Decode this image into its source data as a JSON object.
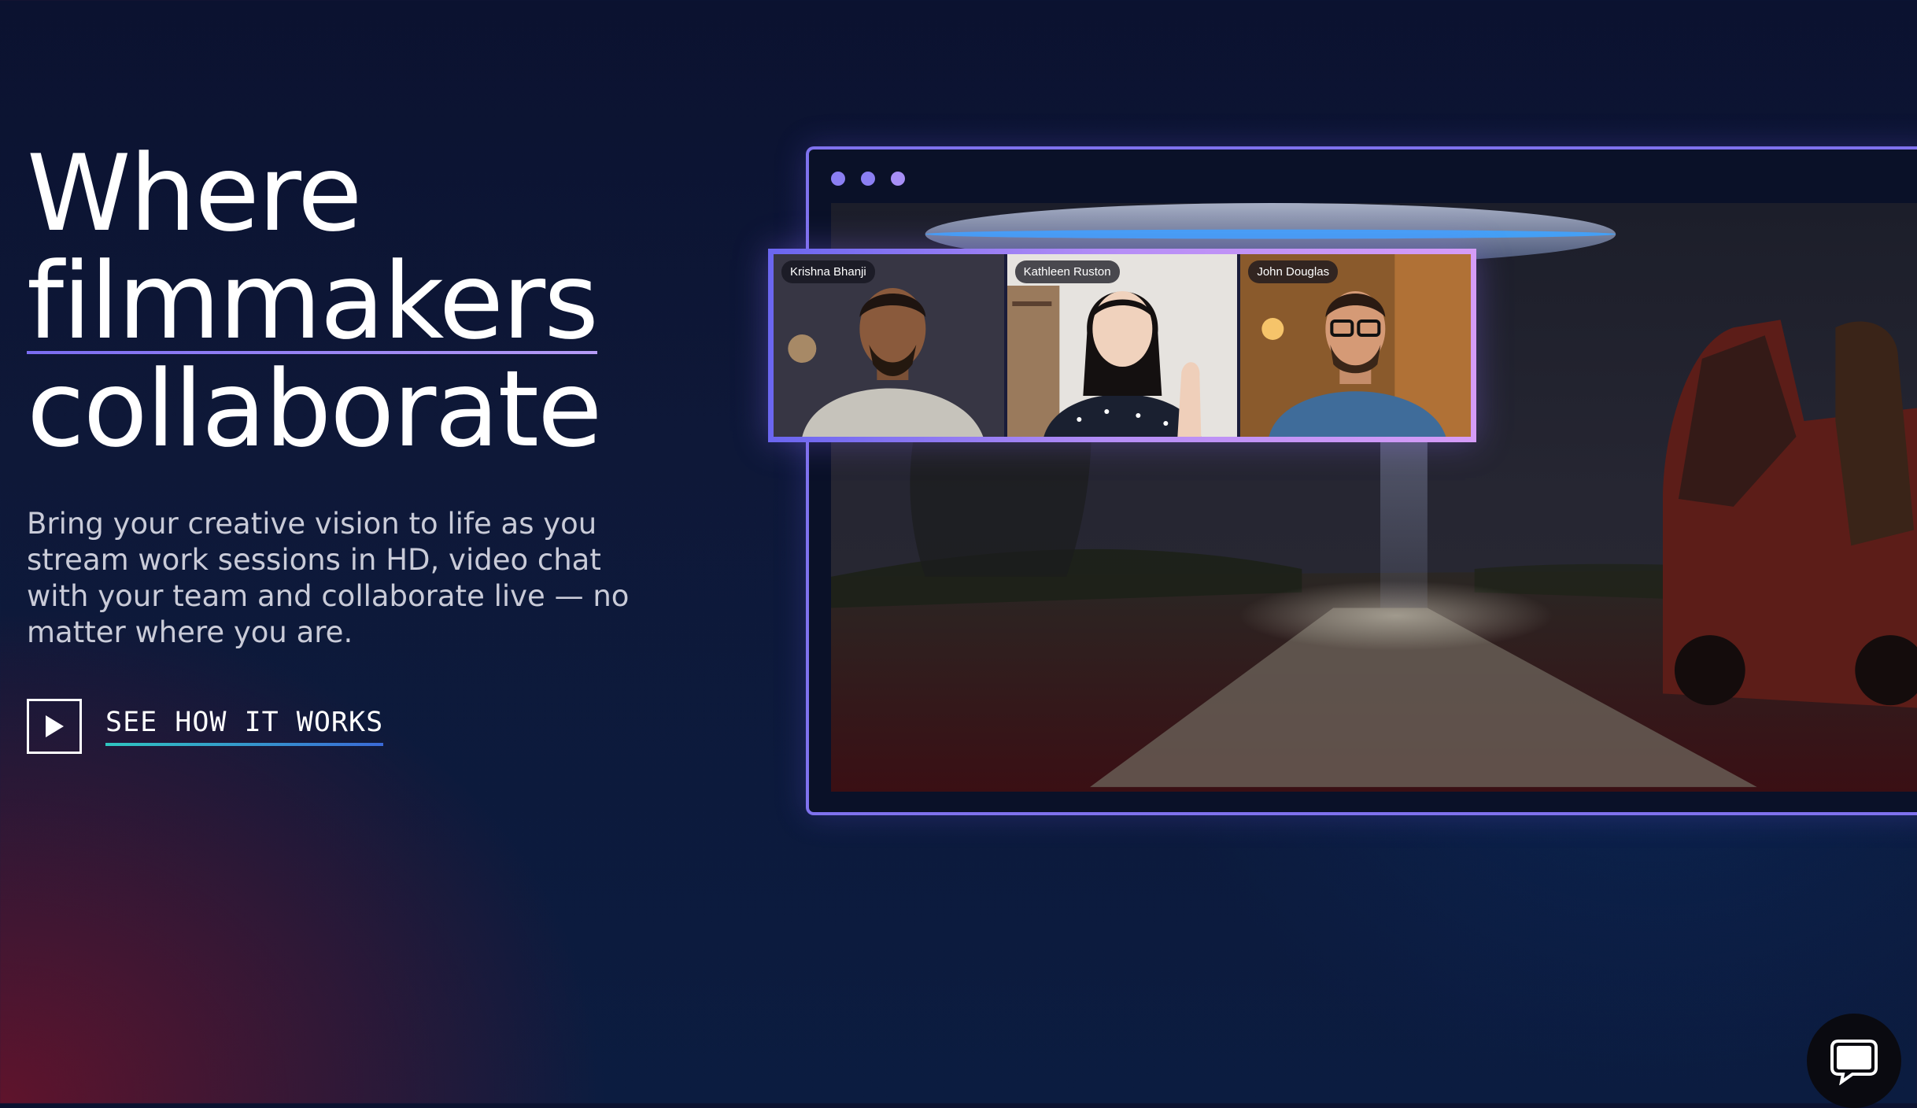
{
  "hero": {
    "headline_line1": "Where",
    "headline_line2": "filmmakers",
    "headline_line3": "collaborate",
    "description": "Bring your creative vision to life as you stream work sessions in HD, video chat with your team and collaborate live — no matter where you are."
  },
  "cta": {
    "label": "SEE HOW IT WORKS",
    "icon": "play-icon"
  },
  "video_call": {
    "participants": [
      {
        "name": "Krishna Bhanji"
      },
      {
        "name": "Kathleen Ruston"
      },
      {
        "name": "John Douglas"
      }
    ]
  },
  "chat_widget": {
    "icon": "chat-bubble-icon"
  },
  "colors": {
    "accent_purple": "#7f72ee",
    "cta_underline_start": "#2fc6c0",
    "cta_underline_end": "#3a6ad8",
    "background": "#0b1230"
  }
}
